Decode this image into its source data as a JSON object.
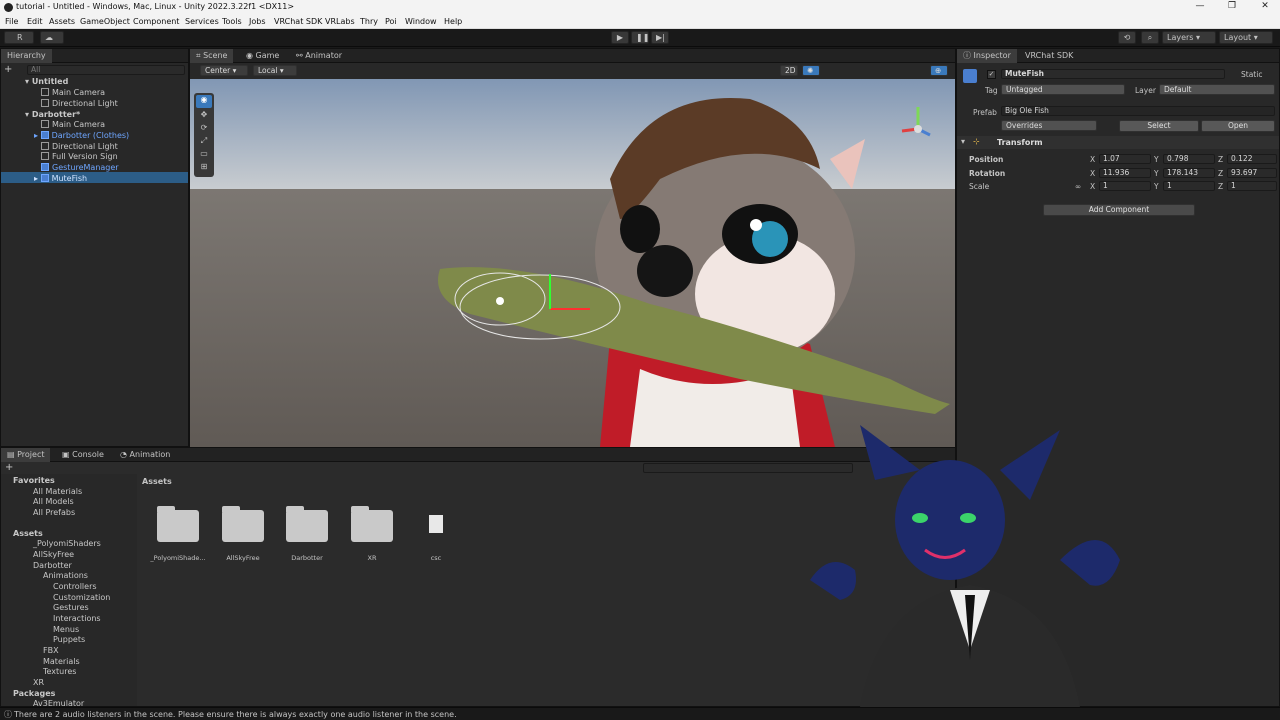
{
  "window": {
    "title": "tutorial - Untitled - Windows, Mac, Linux - Unity 2022.3.22f1 <DX11>",
    "min": "—",
    "max": "❐",
    "close": "✕"
  },
  "menu": [
    "File",
    "Edit",
    "Assets",
    "GameObject",
    "Component",
    "Services",
    "Tools",
    "Jobs",
    "VRChat SDK",
    "VRLabs",
    "Thry",
    "Poi",
    "Window",
    "Help"
  ],
  "toolbar": {
    "account": "R",
    "layers": "Layers",
    "layout": "Layout"
  },
  "hierarchy": {
    "tab": "Hierarchy",
    "search_placeholder": "All",
    "items": [
      {
        "label": "Untitled",
        "kind": "scene"
      },
      {
        "label": "Main Camera",
        "kind": "obj"
      },
      {
        "label": "Directional Light",
        "kind": "obj"
      },
      {
        "label": "Darbotter*",
        "kind": "scene"
      },
      {
        "label": "Main Camera",
        "kind": "obj"
      },
      {
        "label": "Darbotter (Clothes)",
        "kind": "prefab"
      },
      {
        "label": "Directional Light",
        "kind": "obj"
      },
      {
        "label": "Full Version Sign",
        "kind": "obj"
      },
      {
        "label": "GestureManager",
        "kind": "prefab"
      },
      {
        "label": "MuteFish",
        "kind": "prefab"
      }
    ]
  },
  "scene": {
    "tabs": [
      "Scene",
      "Game",
      "Animator"
    ],
    "pivot": "Center",
    "space": "Local",
    "mode2d": "2D"
  },
  "inspector": {
    "tabs": [
      "Inspector",
      "VRChat SDK"
    ],
    "object_name": "MuteFish",
    "static_label": "Static",
    "tag_label": "Tag",
    "tag_value": "Untagged",
    "layer_label": "Layer",
    "layer_value": "Default",
    "prefab_label": "Prefab",
    "prefab_value": "Big Ole Fish",
    "overrides": "Overrides",
    "select": "Select",
    "open": "Open",
    "component": "Transform",
    "rows": [
      {
        "label": "Position",
        "x": "1.07",
        "y": "0.798",
        "z": "0.122"
      },
      {
        "label": "Rotation",
        "x": "11.936",
        "y": "178.143",
        "z": "93.697"
      },
      {
        "label": "Scale",
        "x": "1",
        "y": "1",
        "z": "1"
      }
    ],
    "add_component": "Add Component"
  },
  "project": {
    "tabs": [
      "Project",
      "Console",
      "Animation"
    ],
    "tree": [
      {
        "label": "Favorites",
        "bold": true
      },
      {
        "label": "All Materials"
      },
      {
        "label": "All Models"
      },
      {
        "label": "All Prefabs"
      },
      {
        "label": "Assets",
        "bold": true
      },
      {
        "label": "_PolyomiShaders"
      },
      {
        "label": "AllSkyFree"
      },
      {
        "label": "Darbotter"
      },
      {
        "label": "Animations"
      },
      {
        "label": "Controllers"
      },
      {
        "label": "Customization"
      },
      {
        "label": "Gestures"
      },
      {
        "label": "Interactions"
      },
      {
        "label": "Menus"
      },
      {
        "label": "Puppets"
      },
      {
        "label": "FBX"
      },
      {
        "label": "Materials"
      },
      {
        "label": "Textures"
      },
      {
        "label": "XR"
      },
      {
        "label": "Packages",
        "bold": true
      },
      {
        "label": "Av3Emulator"
      }
    ],
    "breadcrumb": "Assets",
    "assets": [
      "_PolyomiShade...",
      "AllSkyFree",
      "Darbotter",
      "XR",
      "csc"
    ]
  },
  "status": "There are 2 audio listeners in the scene. Please ensure there is always exactly one audio listener in the scene.",
  "colors": {
    "accent": "#3a79bb",
    "prefab_blue": "#6ea6ff",
    "selection": "#2c5d87"
  }
}
